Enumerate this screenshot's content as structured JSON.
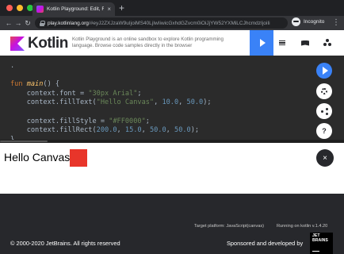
{
  "browser": {
    "tab_title": "Kotlin Playground: Edit, Run, Sh…",
    "tab_close": "×",
    "new_tab": "+",
    "url_host": "play.kotlinlang.org",
    "url_path": "/#eyJ2ZXJzaW9uIjoiMS40LjIwIiwicGxhdGZvcm0iOiJjYW52YXMiLCJhcmdzIjoiIi",
    "back": "←",
    "forward": "→",
    "reload": "↻",
    "profile_label": "Incognito",
    "menu": "⋮"
  },
  "header": {
    "logo_text": "Kotlin",
    "description": "Kotlin Playground is an online sandbox to explore Kotlin programming language. Browse code samples directly in the browser"
  },
  "editor": {
    "lines": [
      {
        "spans": [
          {
            "t": ".",
            "c": ""
          }
        ]
      },
      {
        "spans": []
      },
      {
        "spans": [
          {
            "t": "fun ",
            "c": "kw"
          },
          {
            "t": "main",
            "c": "fn"
          },
          {
            "t": "() {",
            "c": ""
          }
        ]
      },
      {
        "spans": [
          {
            "t": "    context.font = ",
            "c": ""
          },
          {
            "t": "\"30px Arial\"",
            "c": "str"
          },
          {
            "t": ";",
            "c": ""
          }
        ]
      },
      {
        "spans": [
          {
            "t": "    context.fillText(",
            "c": ""
          },
          {
            "t": "\"Hello Canvas\"",
            "c": "str"
          },
          {
            "t": ", ",
            "c": ""
          },
          {
            "t": "10.0",
            "c": "num"
          },
          {
            "t": ", ",
            "c": ""
          },
          {
            "t": "50.0",
            "c": "num"
          },
          {
            "t": ");",
            "c": ""
          }
        ]
      },
      {
        "spans": []
      },
      {
        "spans": [
          {
            "t": "    context.fillStyle = ",
            "c": ""
          },
          {
            "t": "\"#FF0000\"",
            "c": "str"
          },
          {
            "t": ";",
            "c": ""
          }
        ]
      },
      {
        "spans": [
          {
            "t": "    context.fillRect(",
            "c": ""
          },
          {
            "t": "200.0",
            "c": "num"
          },
          {
            "t": ", ",
            "c": ""
          },
          {
            "t": "15.0",
            "c": "num"
          },
          {
            "t": ", ",
            "c": ""
          },
          {
            "t": "50.0",
            "c": "num"
          },
          {
            "t": ", ",
            "c": ""
          },
          {
            "t": "50.0",
            "c": "num"
          },
          {
            "t": ");",
            "c": ""
          }
        ]
      },
      {
        "spans": [
          {
            "t": "}",
            "c": ""
          }
        ]
      }
    ]
  },
  "side": {
    "help": "?"
  },
  "output": {
    "text": "Hello Canvas",
    "rect_color": "#e8352a",
    "close": "×"
  },
  "status": {
    "target": "Target platform: JavaScript(canvas)",
    "running": "Running on kotlin v.1.4.20"
  },
  "footer": {
    "copyright": "© 2000-2020 JetBrains. All rights reserved",
    "sponsor": "Sponsored and developed by",
    "jb_logo_text": "JET\nBRAINS"
  },
  "colors": {
    "accent": "#3a82f7",
    "dark_bg": "#27282c",
    "editor_bg": "#2b2b2b"
  }
}
